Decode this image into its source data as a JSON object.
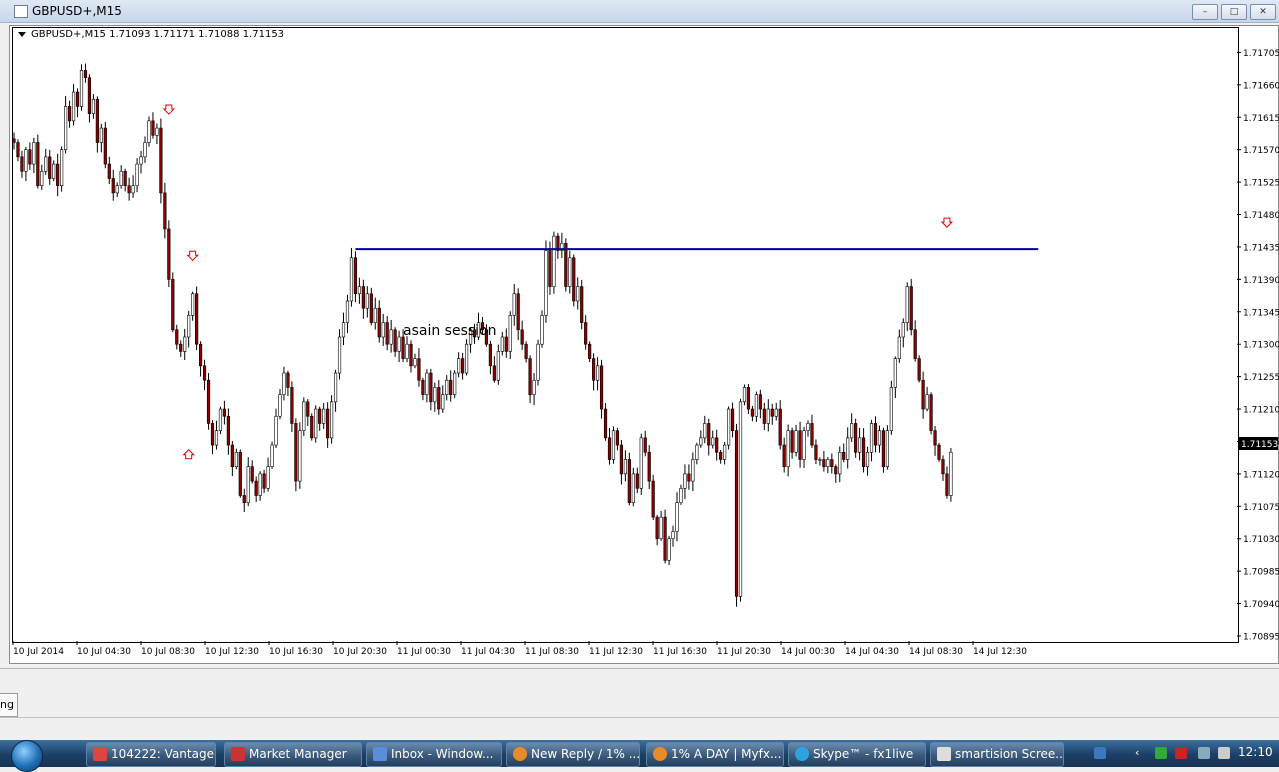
{
  "window": {
    "title": "GBPUSD+,M15",
    "minimize": "–",
    "maximize": "□",
    "close": "✕"
  },
  "chart_info": "GBPUSD+,M15  1.71093 1.71171 1.71088 1.71153",
  "annotation": "asain session",
  "price_tag": "1.71153",
  "bottom_tab_label": "ng",
  "colors": {
    "bull_candle": "#ffffff",
    "bear_candle": "#8b0000",
    "wick": "#000000",
    "resistance_line": "#0000a0",
    "arrow": "#e00000",
    "price_tag_bg": "#000000",
    "taskbar": "#1c3f66"
  },
  "chart_data": {
    "type": "candlestick",
    "symbol": "GBPUSD+",
    "timeframe": "M15",
    "ylim": [
      1.70895,
      1.71725
    ],
    "y_ticks": [
      "1.71705",
      "1.71660",
      "1.71615",
      "1.71570",
      "1.71525",
      "1.71480",
      "1.71435",
      "1.71390",
      "1.71345",
      "1.71300",
      "1.71255",
      "1.71210",
      "1.71165",
      "1.71120",
      "1.71075",
      "1.71030",
      "1.70985",
      "1.70940",
      "1.70895"
    ],
    "x_ticks": [
      "10 Jul 2014",
      "10 Jul 04:30",
      "10 Jul 08:30",
      "10 Jul 12:30",
      "10 Jul 16:30",
      "10 Jul 20:30",
      "11 Jul 00:30",
      "11 Jul 04:30",
      "11 Jul 08:30",
      "11 Jul 12:30",
      "11 Jul 16:30",
      "11 Jul 20:30",
      "14 Jul 00:30",
      "14 Jul 04:30",
      "14 Jul 08:30",
      "14 Jul 12:30"
    ],
    "horizontal_line": {
      "price": 1.71432,
      "from_bar": 86,
      "to_bar": 258
    },
    "last_price": 1.71153,
    "closes": [
      1.7158,
      1.7156,
      1.7154,
      1.7157,
      1.7155,
      1.7158,
      1.7152,
      1.7154,
      1.7156,
      1.7153,
      1.7155,
      1.7152,
      1.7157,
      1.7163,
      1.7161,
      1.7165,
      1.7163,
      1.7168,
      1.7167,
      1.7162,
      1.7164,
      1.7158,
      1.716,
      1.7155,
      1.7153,
      1.7151,
      1.7152,
      1.7154,
      1.7152,
      1.7151,
      1.7152,
      1.7155,
      1.7156,
      1.7158,
      1.7161,
      1.7159,
      1.716,
      1.7151,
      1.7146,
      1.7139,
      1.7132,
      1.713,
      1.7129,
      1.7131,
      1.7134,
      1.7137,
      1.713,
      1.7127,
      1.7125,
      1.7119,
      1.7116,
      1.7118,
      1.7121,
      1.712,
      1.7116,
      1.7113,
      1.7115,
      1.7109,
      1.7108,
      1.7113,
      1.7111,
      1.7109,
      1.7112,
      1.711,
      1.7113,
      1.7116,
      1.712,
      1.7123,
      1.7126,
      1.7124,
      1.7119,
      1.7111,
      1.7118,
      1.7122,
      1.712,
      1.7117,
      1.7121,
      1.7119,
      1.7121,
      1.7117,
      1.7122,
      1.7126,
      1.7131,
      1.7133,
      1.7136,
      1.7142,
      1.7137,
      1.7138,
      1.7135,
      1.7137,
      1.7133,
      1.7135,
      1.7131,
      1.7133,
      1.713,
      1.7132,
      1.7129,
      1.7131,
      1.7128,
      1.713,
      1.7127,
      1.7128,
      1.7125,
      1.7123,
      1.7126,
      1.7122,
      1.7124,
      1.7121,
      1.7123,
      1.7125,
      1.7123,
      1.7126,
      1.7128,
      1.7126,
      1.713,
      1.7132,
      1.7131,
      1.7133,
      1.7132,
      1.713,
      1.7127,
      1.7125,
      1.7129,
      1.7131,
      1.7129,
      1.7134,
      1.7137,
      1.7132,
      1.713,
      1.7128,
      1.7123,
      1.7125,
      1.713,
      1.7134,
      1.7143,
      1.7138,
      1.7145,
      1.7143,
      1.7144,
      1.7138,
      1.7142,
      1.7136,
      1.7138,
      1.7133,
      1.713,
      1.7128,
      1.7125,
      1.7127,
      1.7121,
      1.7117,
      1.7114,
      1.7118,
      1.7116,
      1.7112,
      1.7114,
      1.7108,
      1.7112,
      1.711,
      1.7117,
      1.7115,
      1.7111,
      1.7106,
      1.7103,
      1.7106,
      1.71,
      1.7103,
      1.7104,
      1.7108,
      1.711,
      1.7112,
      1.7111,
      1.7114,
      1.7116,
      1.7117,
      1.7119,
      1.7116,
      1.7117,
      1.7115,
      1.7114,
      1.7116,
      1.7121,
      1.7118,
      1.7095,
      1.7122,
      1.7124,
      1.7121,
      1.712,
      1.7123,
      1.7121,
      1.7119,
      1.7121,
      1.712,
      1.7121,
      1.7116,
      1.7113,
      1.7118,
      1.7115,
      1.7118,
      1.7114,
      1.7118,
      1.7119,
      1.7116,
      1.7114,
      1.7114,
      1.7113,
      1.7114,
      1.7113,
      1.7112,
      1.7115,
      1.7114,
      1.7117,
      1.7119,
      1.7115,
      1.7117,
      1.7113,
      1.7115,
      1.7119,
      1.7116,
      1.7118,
      1.7113,
      1.7118,
      1.7124,
      1.7128,
      1.7131,
      1.7133,
      1.7138,
      1.7132,
      1.7128,
      1.7125,
      1.7121,
      1.7123,
      1.7118,
      1.7116,
      1.7114,
      1.7112,
      1.7109,
      1.7115
    ],
    "markers": [
      {
        "type": "down-arrow",
        "bar": 39,
        "price": 1.71625
      },
      {
        "type": "down-arrow",
        "bar": 45,
        "price": 1.71422
      },
      {
        "type": "up-arrow",
        "bar": 44,
        "price": 1.71148
      },
      {
        "type": "down-arrow",
        "bar": 235,
        "price": 1.71468
      }
    ]
  }
}
